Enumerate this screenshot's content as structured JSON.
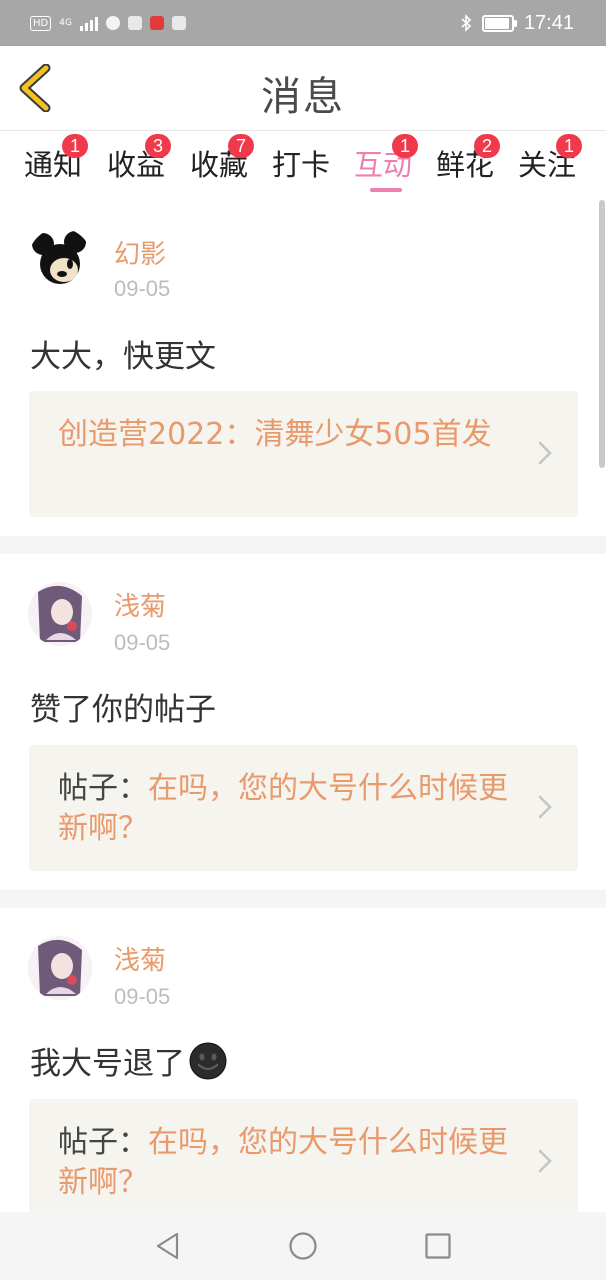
{
  "status_bar": {
    "hd_label": "HD",
    "network_label": "4G",
    "time": "17:41"
  },
  "header": {
    "title": "消息"
  },
  "tabs": [
    {
      "label": "通知",
      "badge": "1"
    },
    {
      "label": "收益",
      "badge": "3"
    },
    {
      "label": "收藏",
      "badge": "7"
    },
    {
      "label": "打卡",
      "badge": ""
    },
    {
      "label": "互动",
      "badge": "1",
      "active": true
    },
    {
      "label": "鲜花",
      "badge": "2"
    },
    {
      "label": "关注",
      "badge": "1"
    }
  ],
  "messages": [
    {
      "username": "幻影",
      "date": "09-05",
      "text": "大大，快更文",
      "ref_prefix": "",
      "ref_text": "创造营2022：清舞少女505首发"
    },
    {
      "username": "浅菊",
      "date": "09-05",
      "text": "赞了你的帖子",
      "ref_prefix": "帖子：",
      "ref_text": "在吗，您的大号什么时候更新啊？"
    },
    {
      "username": "浅菊",
      "date": "09-05",
      "text": "我大号退了",
      "emoji": "dark-smiley-emoji",
      "ref_prefix": "帖子：",
      "ref_text": "在吗，您的大号什么时候更新啊？"
    }
  ],
  "colors": {
    "accent": "#ee7fae",
    "badge": "#f0394b",
    "username": "#e99a6c",
    "back_arrow": "#f3c21e"
  }
}
